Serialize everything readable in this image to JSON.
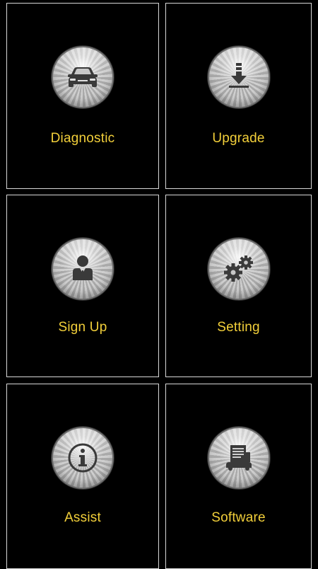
{
  "tiles": [
    {
      "label": "Diagnostic",
      "icon": "car-icon"
    },
    {
      "label": "Upgrade",
      "icon": "download-icon"
    },
    {
      "label": "Sign Up",
      "icon": "user-icon"
    },
    {
      "label": "Setting",
      "icon": "gears-icon"
    },
    {
      "label": "Assist",
      "icon": "info-icon"
    },
    {
      "label": "Software",
      "icon": "software-icon"
    }
  ],
  "colors": {
    "background": "#000000",
    "label": "#f2cf3a",
    "border": "#d8d8d8"
  }
}
